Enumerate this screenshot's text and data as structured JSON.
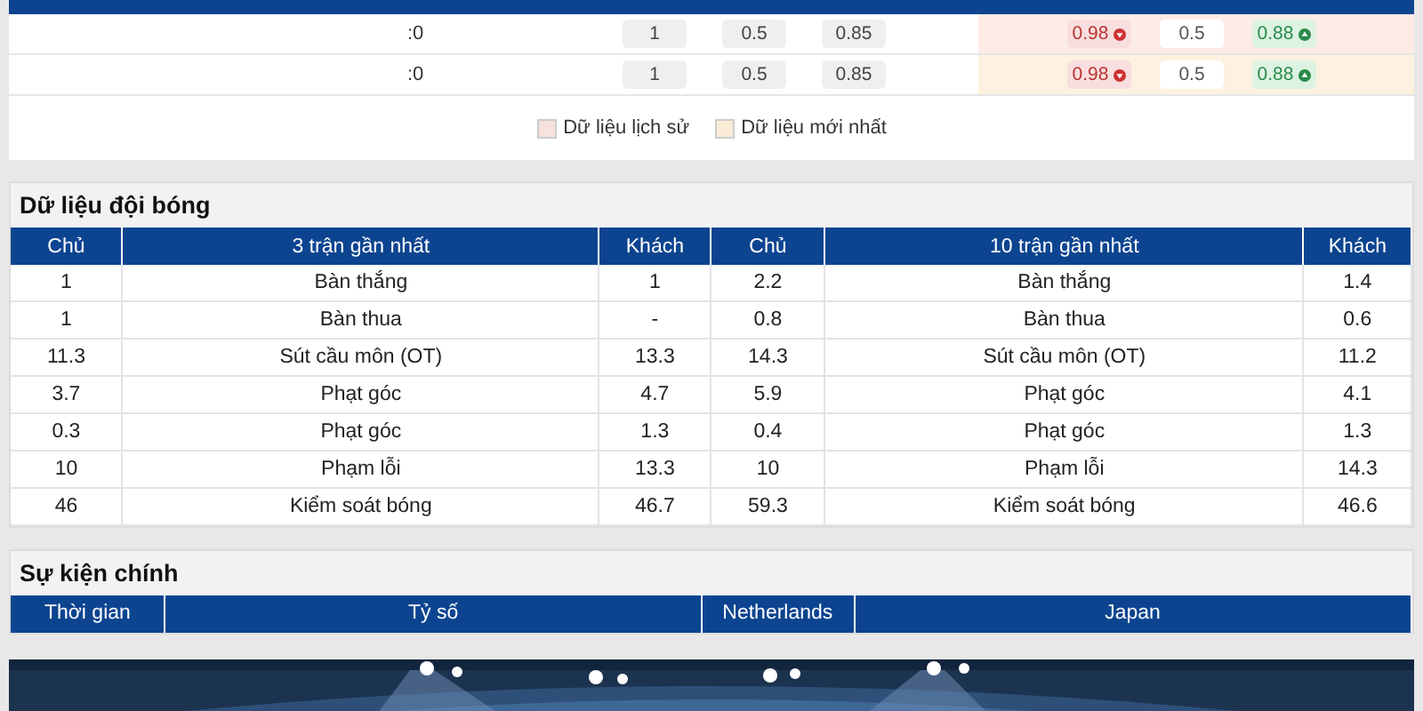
{
  "odds_table": {
    "rows": [
      {
        "score": ":0",
        "early": [
          "1",
          "0.5",
          "0.85"
        ],
        "live": [
          {
            "value": "0.98",
            "rising": false,
            "falling": true
          },
          {
            "value": "0.5",
            "rising": false,
            "falling": false
          },
          {
            "value": "0.88",
            "rising": true,
            "falling": false
          }
        ],
        "color": "#fdebe6"
      },
      {
        "score": ":0",
        "early": [
          "1",
          "0.5",
          "0.85"
        ],
        "live": [
          {
            "value": "0.98",
            "rising": false,
            "falling": true
          },
          {
            "value": "0.5",
            "rising": false,
            "falling": false
          },
          {
            "value": "0.88",
            "rising": true,
            "falling": false
          }
        ],
        "color": "#fdf1df"
      }
    ],
    "legend": [
      {
        "label": "Dữ liệu lịch sử",
        "color": "#f6e1dd"
      },
      {
        "label": "Dữ liệu mới nhất",
        "color": "#fbecd8"
      }
    ]
  },
  "team_data": {
    "title": "Dữ liệu đội bóng",
    "tables": [
      {
        "columns": [
          "Chủ",
          "3 trận gần nhất",
          "Khách"
        ],
        "rows": [
          [
            "1",
            "Bàn thắng",
            "1"
          ],
          [
            "1",
            "Bàn thua",
            "-"
          ],
          [
            "11.3",
            "Sút cầu môn (OT)",
            "13.3"
          ],
          [
            "3.7",
            "Phạt góc",
            "4.7"
          ],
          [
            "0.3",
            "Phạt góc",
            "1.3"
          ],
          [
            "10",
            "Phạm lỗi",
            "13.3"
          ],
          [
            "46",
            "Kiểm soát bóng",
            "46.7"
          ]
        ]
      },
      {
        "columns": [
          "Chủ",
          "10 trận gần nhất",
          "Khách"
        ],
        "rows": [
          [
            "2.2",
            "Bàn thắng",
            "1.4"
          ],
          [
            "0.8",
            "Bàn thua",
            "0.6"
          ],
          [
            "14.3",
            "Sút cầu môn (OT)",
            "11.2"
          ],
          [
            "5.9",
            "Phạt góc",
            "4.1"
          ],
          [
            "0.4",
            "Phạt góc",
            "1.3"
          ],
          [
            "10",
            "Phạm lỗi",
            "14.3"
          ],
          [
            "59.3",
            "Kiểm soát bóng",
            "46.6"
          ]
        ]
      }
    ]
  },
  "main_events": {
    "title": "Sự kiện chính",
    "columns": [
      "Thời gian",
      "Tỷ số",
      "Netherlands",
      "Japan"
    ]
  }
}
